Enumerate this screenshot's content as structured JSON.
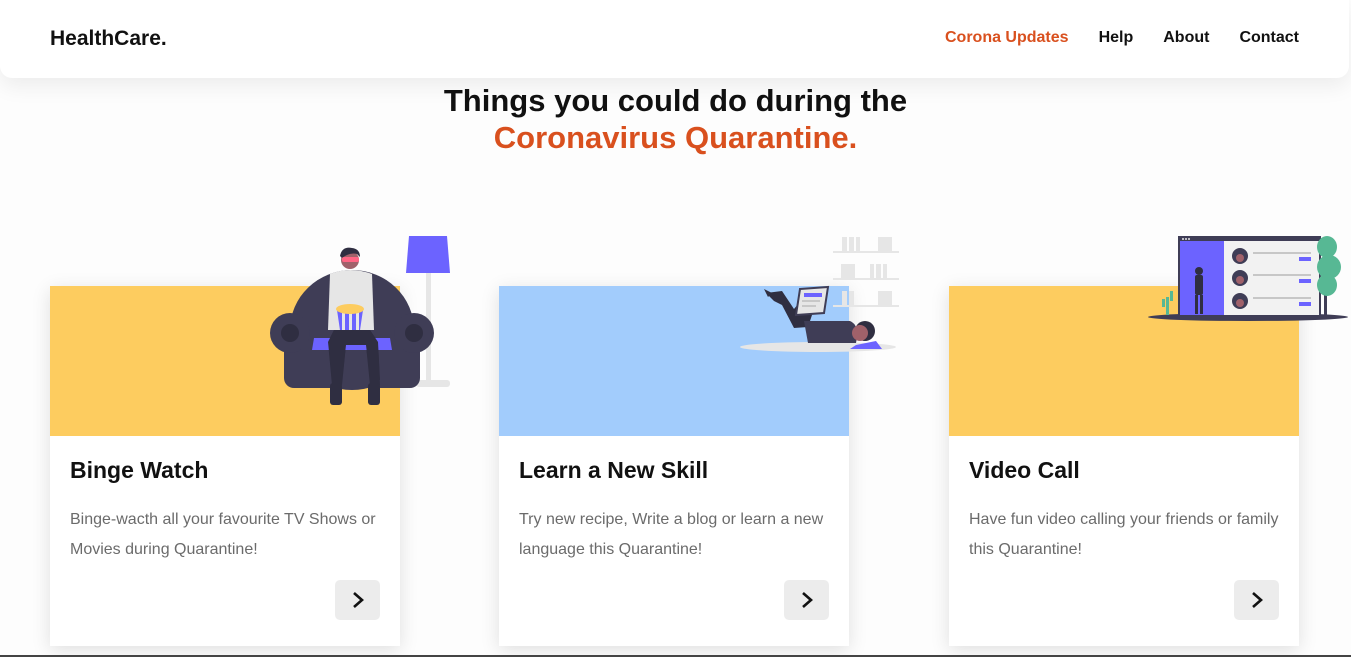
{
  "brand": "HealthCare.",
  "nav": [
    {
      "label": "Corona Updates",
      "active": true
    },
    {
      "label": "Help",
      "active": false
    },
    {
      "label": "About",
      "active": false
    },
    {
      "label": "Contact",
      "active": false
    }
  ],
  "headline": {
    "line1": "Things you could do during the",
    "line2": "Coronavirus Quarantine."
  },
  "cards": [
    {
      "title": "Binge Watch",
      "description": "Binge-wacth all your favourite TV Shows or Movies during Quarantine!",
      "banner_color": "#fdcc5f",
      "illustration": "binge-watch-illustration"
    },
    {
      "title": "Learn a New Skill",
      "description": "Try new recipe, Write a blog or learn a new language this Quarantine!",
      "banner_color": "#a2ccfc",
      "illustration": "learning-illustration"
    },
    {
      "title": "Video Call",
      "description": "Have fun video calling your friends or family this Quarantine!",
      "banner_color": "#fdcc5f",
      "illustration": "video-call-illustration"
    }
  ],
  "colors": {
    "accent": "#d9501e",
    "purple": "#6c63ff",
    "dark": "#3f3d56"
  }
}
